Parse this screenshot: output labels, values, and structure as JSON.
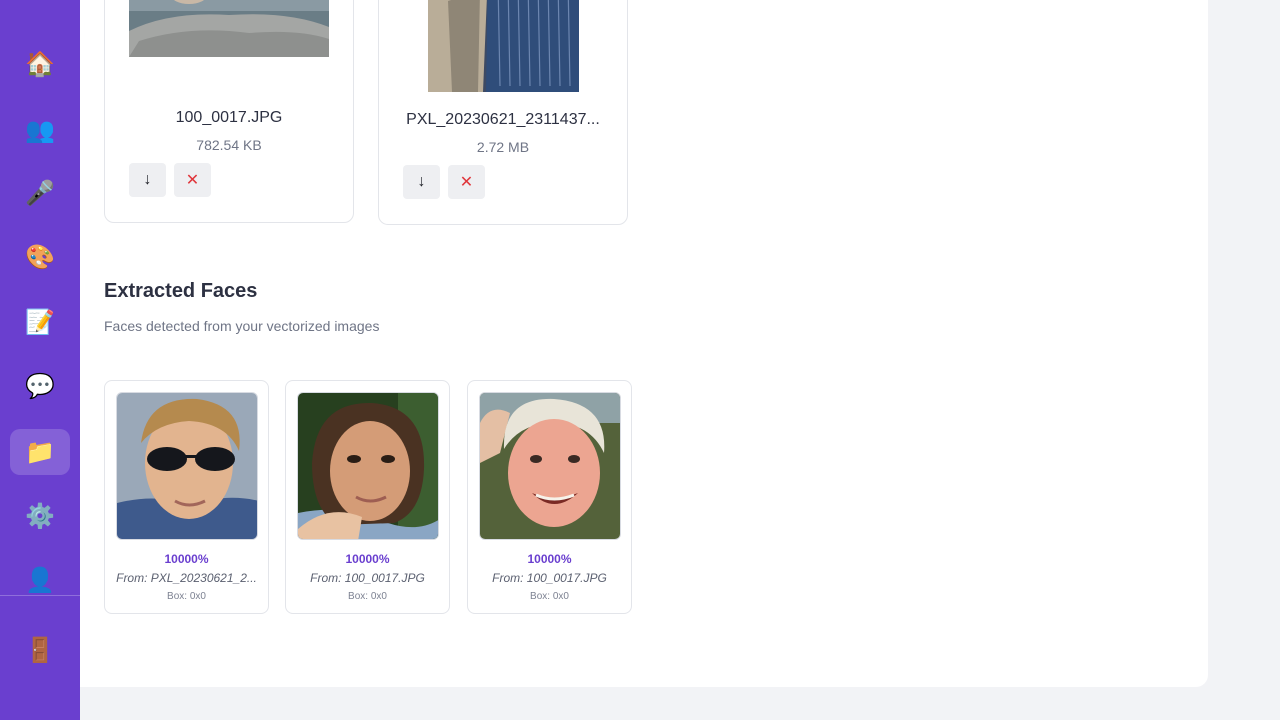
{
  "sidebar": {
    "items": [
      {
        "id": "home",
        "icon": "🏠",
        "icon_name": "home-icon"
      },
      {
        "id": "people",
        "icon": "👥",
        "icon_name": "people-icon"
      },
      {
        "id": "voice",
        "icon": "🎤",
        "icon_name": "microphone-icon"
      },
      {
        "id": "style",
        "icon": "🎨",
        "icon_name": "palette-icon"
      },
      {
        "id": "notes",
        "icon": "📝",
        "icon_name": "memo-icon"
      },
      {
        "id": "chat",
        "icon": "💬",
        "icon_name": "chat-icon"
      },
      {
        "id": "files",
        "icon": "📁",
        "icon_name": "folder-icon",
        "active": true
      },
      {
        "id": "settings",
        "icon": "⚙️",
        "icon_name": "gear-icon"
      },
      {
        "id": "profile",
        "icon": "👤",
        "icon_name": "user-icon"
      }
    ],
    "logout": {
      "icon": "🚪",
      "icon_name": "door-icon"
    }
  },
  "files": [
    {
      "name": "100_0017.JPG",
      "size": "782.54 KB"
    },
    {
      "name": "PXL_20230621_2311437...",
      "size": "2.72 MB"
    }
  ],
  "buttons": {
    "download_glyph": "↓",
    "remove_glyph": "✕"
  },
  "faces_section": {
    "title": "Extracted Faces",
    "subtitle": "Faces detected from your vectorized images"
  },
  "faces": [
    {
      "confidence": "10000%",
      "source": "From: PXL_20230621_2...",
      "box": "Box: 0x0"
    },
    {
      "confidence": "10000%",
      "source": "From: 100_0017.JPG",
      "box": "Box: 0x0"
    },
    {
      "confidence": "10000%",
      "source": "From: 100_0017.JPG",
      "box": "Box: 0x0"
    }
  ],
  "colors": {
    "accent": "#6a3fcf",
    "danger": "#e0363c"
  }
}
